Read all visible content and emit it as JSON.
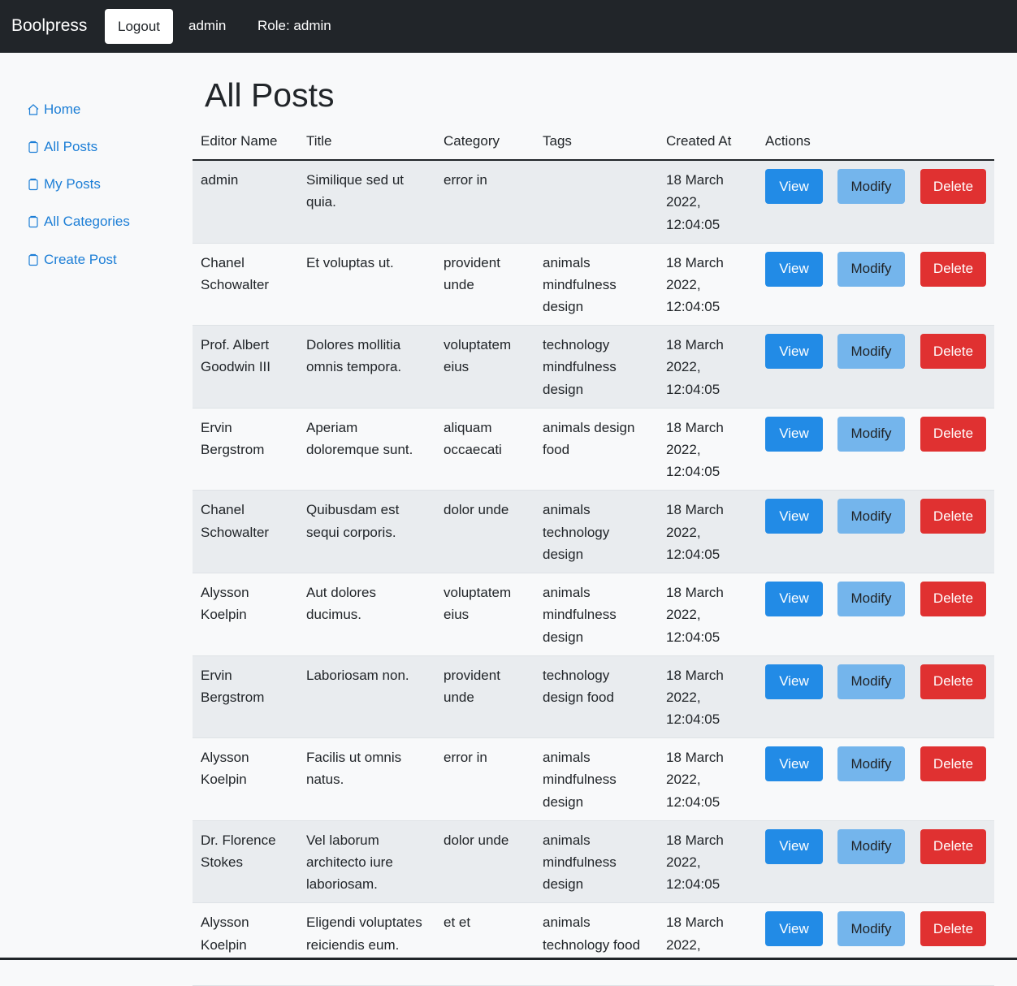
{
  "navbar": {
    "brand": "Boolpress",
    "logout_label": "Logout",
    "user": "admin",
    "role": "Role: admin"
  },
  "sidebar": {
    "items": [
      {
        "label": "Home",
        "icon": "house-icon"
      },
      {
        "label": "All Posts",
        "icon": "document-icon"
      },
      {
        "label": "My Posts",
        "icon": "document-icon"
      },
      {
        "label": "All Categories",
        "icon": "document-icon"
      },
      {
        "label": "Create Post",
        "icon": "document-icon"
      }
    ]
  },
  "main": {
    "title": "All Posts",
    "columns": [
      "Editor Name",
      "Title",
      "Category",
      "Tags",
      "Created At",
      "Actions"
    ],
    "actions": {
      "view": "View",
      "modify": "Modify",
      "delete": "Delete"
    },
    "rows": [
      {
        "editor": [
          "admin"
        ],
        "title": [
          "Similique sed ut",
          "quia."
        ],
        "category": [
          "error in"
        ],
        "tags": [],
        "created": [
          "18 March",
          "2022,",
          "12:04:05"
        ]
      },
      {
        "editor": [
          "Chanel",
          "Schowalter"
        ],
        "title": [
          "Et voluptas ut."
        ],
        "category": [
          "provident",
          "unde"
        ],
        "tags": [
          "animals",
          "mindfulness",
          "design"
        ],
        "created": [
          "18 March",
          "2022,",
          "12:04:05"
        ]
      },
      {
        "editor": [
          "Prof. Albert",
          "Goodwin III"
        ],
        "title": [
          "Dolores mollitia",
          "omnis tempora."
        ],
        "category": [
          "voluptatem",
          "eius"
        ],
        "tags": [
          "technology",
          "mindfulness",
          "design"
        ],
        "created": [
          "18 March",
          "2022,",
          "12:04:05"
        ]
      },
      {
        "editor": [
          "Ervin",
          "Bergstrom"
        ],
        "title": [
          "Aperiam",
          "doloremque sunt."
        ],
        "category": [
          "aliquam",
          "occaecati"
        ],
        "tags": [
          "animals design",
          "food"
        ],
        "created": [
          "18 March",
          "2022,",
          "12:04:05"
        ]
      },
      {
        "editor": [
          "Chanel",
          "Schowalter"
        ],
        "title": [
          "Quibusdam est",
          "sequi corporis."
        ],
        "category": [
          "dolor unde"
        ],
        "tags": [
          "animals",
          "technology",
          "design"
        ],
        "created": [
          "18 March",
          "2022,",
          "12:04:05"
        ]
      },
      {
        "editor": [
          "Alysson",
          "Koelpin"
        ],
        "title": [
          "Aut dolores",
          "ducimus."
        ],
        "category": [
          "voluptatem",
          "eius"
        ],
        "tags": [
          "animals",
          "mindfulness",
          "design"
        ],
        "created": [
          "18 March",
          "2022,",
          "12:04:05"
        ]
      },
      {
        "editor": [
          "Ervin",
          "Bergstrom"
        ],
        "title": [
          "Laboriosam non."
        ],
        "category": [
          "provident",
          "unde"
        ],
        "tags": [
          "technology",
          "design food"
        ],
        "created": [
          "18 March",
          "2022,",
          "12:04:05"
        ]
      },
      {
        "editor": [
          "Alysson",
          "Koelpin"
        ],
        "title": [
          "Facilis ut omnis",
          "natus."
        ],
        "category": [
          "error in"
        ],
        "tags": [
          "animals",
          "mindfulness",
          "design"
        ],
        "created": [
          "18 March",
          "2022,",
          "12:04:05"
        ]
      },
      {
        "editor": [
          "Dr. Florence",
          "Stokes"
        ],
        "title": [
          "Vel laborum",
          "architecto iure",
          "laboriosam."
        ],
        "category": [
          "dolor unde"
        ],
        "tags": [
          "animals",
          "mindfulness",
          "design"
        ],
        "created": [
          "18 March",
          "2022,",
          "12:04:05"
        ]
      },
      {
        "editor": [
          "Alysson",
          "Koelpin"
        ],
        "title": [
          "Eligendi voluptates",
          "reiciendis eum."
        ],
        "category": [
          "et et"
        ],
        "tags": [
          "animals",
          "technology food"
        ],
        "created": [
          "18 March",
          "2022,"
        ]
      }
    ]
  },
  "colors": {
    "navbar_bg": "#212529",
    "link": "#1c7ed6",
    "view_btn": "#228be6",
    "modify_btn": "#74b5ec",
    "delete_btn": "#e03131",
    "row_stripe": "#e9ecef"
  }
}
